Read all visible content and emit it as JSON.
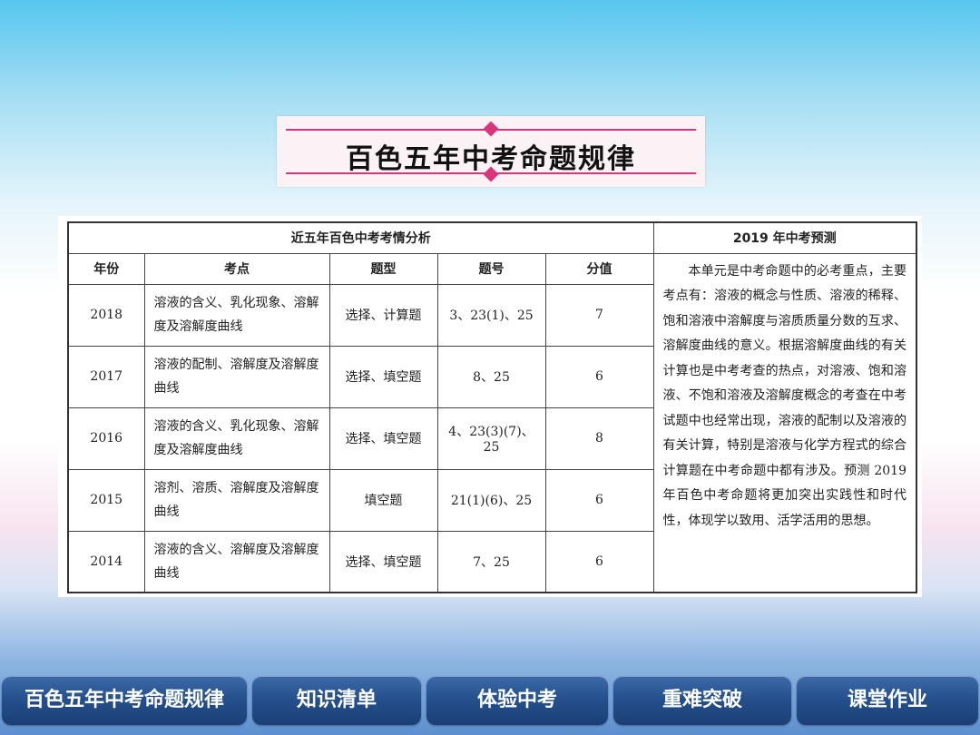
{
  "title": "百色五年中考命题规律",
  "table": {
    "header_left": "近五年百色中考考情分析",
    "header_right": "2019 年中考预测",
    "columns": [
      "年份",
      "考点",
      "题型",
      "题号",
      "分值"
    ],
    "rows": [
      {
        "year": "2018",
        "topic": "溶液的含义、乳化现象、溶解度及溶解度曲线",
        "type": "选择、计算题",
        "number": "3、23(1)、25",
        "score": "7"
      },
      {
        "year": "2017",
        "topic": "溶液的配制、溶解度及溶解度曲线",
        "type": "选择、填空题",
        "number": "8、25",
        "score": "6"
      },
      {
        "year": "2016",
        "topic": "溶液的含义、乳化现象、溶解度及溶解度曲线",
        "type": "选择、填空题",
        "number": "4、23(3)(7)、25",
        "score": "8"
      },
      {
        "year": "2015",
        "topic": "溶剂、溶质、溶解度及溶解度曲线",
        "type": "填空题",
        "number": "21(1)(6)、25",
        "score": "6"
      },
      {
        "year": "2014",
        "topic": "溶液的含义、溶解度及溶解度曲线",
        "type": "选择、填空题",
        "number": "7、25",
        "score": "6"
      }
    ],
    "prediction": "本单元是中考命题中的必考重点，主要考点有：溶液的概念与性质、溶液的稀释、饱和溶液中溶解度与溶质质量分数的互求、溶解度曲线的意义。根据溶解度曲线的有关计算也是中考考查的热点，对溶液、饱和溶液、不饱和溶液及溶解度概念的考查在中考试题中也经常出现，溶液的配制以及溶液的有关计算，特别是溶液与化学方程式的综合计算题在中考命题中都有涉及。预测 2019 年百色中考命题将更加突出实践性和时代性，体现学以致用、活学活用的思想。"
  },
  "nav": [
    "百色五年中考命题规律",
    "知识清单",
    "体验中考",
    "重难突破",
    "课堂作业"
  ],
  "colors": {
    "accent": "#d8357a",
    "nav_bg": "#244f8c",
    "sky": "#57c6ee"
  }
}
